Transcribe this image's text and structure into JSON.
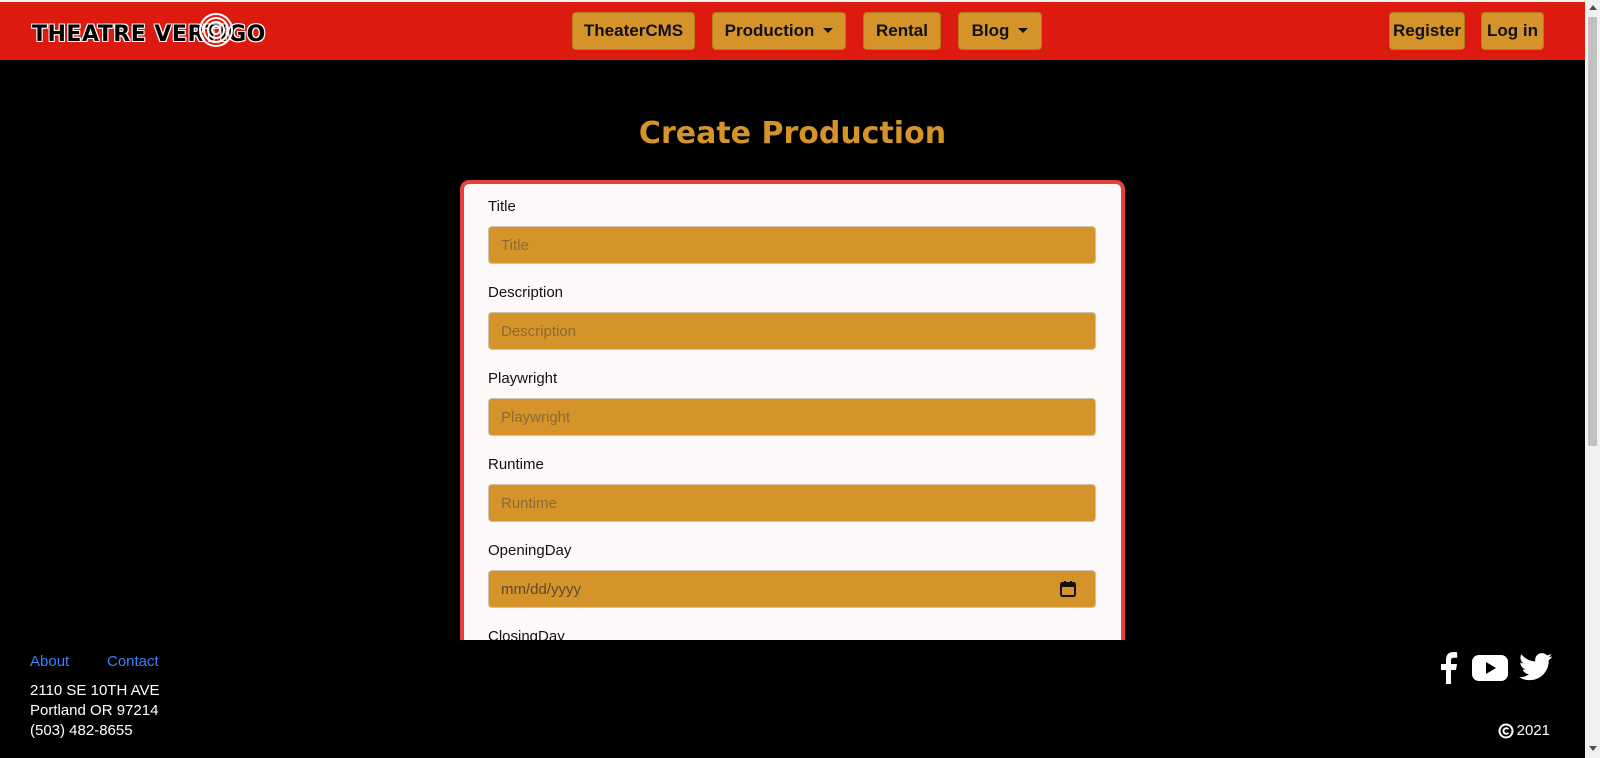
{
  "brand": {
    "logo_text": "THEATRE VERTIGO"
  },
  "nav": {
    "items": [
      {
        "label": "TheaterCMS"
      },
      {
        "label": "Production"
      },
      {
        "label": "Rental"
      },
      {
        "label": "Blog"
      }
    ],
    "register_label": "Register",
    "login_label": "Log in"
  },
  "page": {
    "title": "Create Production"
  },
  "form": {
    "fields": [
      {
        "label": "Title",
        "placeholder": "Title",
        "value": ""
      },
      {
        "label": "Description",
        "placeholder": "Description",
        "value": ""
      },
      {
        "label": "Playwright",
        "placeholder": "Playwright",
        "value": ""
      },
      {
        "label": "Runtime",
        "placeholder": "Runtime",
        "value": ""
      },
      {
        "label": "OpeningDay",
        "placeholder": "mm/dd/yyyy",
        "value": ""
      },
      {
        "label": "ClosingDay"
      }
    ]
  },
  "footer": {
    "about_label": "About",
    "contact_label": "Contact",
    "address_line1": "2110 SE 10TH AVE",
    "address_line2": "Portland OR 97214",
    "phone": "(503) 482-8655",
    "copyright_year": "2021",
    "social_icons": [
      "facebook-icon",
      "youtube-icon",
      "twitter-icon"
    ]
  },
  "colors": {
    "navbar": "#dc1a10",
    "button": "#d5942a",
    "title": "#d5942a",
    "card_border": "#e3423a",
    "link": "#3b82f6"
  }
}
